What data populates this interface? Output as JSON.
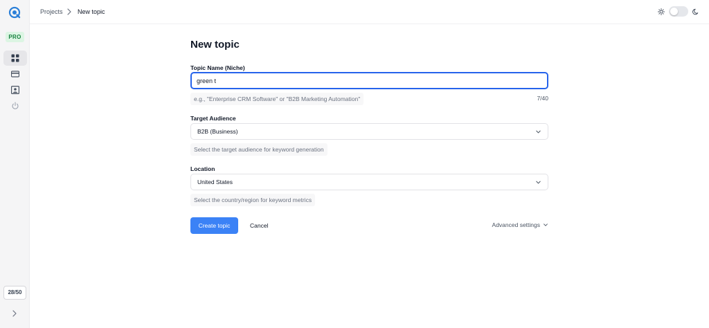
{
  "sidebar": {
    "badge": "PRO",
    "credits": "28/50",
    "items": [
      {
        "icon": "grid-icon",
        "active": true
      },
      {
        "icon": "card-icon",
        "active": false
      },
      {
        "icon": "user-card-icon",
        "active": false
      },
      {
        "icon": "power-icon",
        "active": false
      }
    ]
  },
  "header": {
    "breadcrumb": [
      "Projects",
      "New topic"
    ],
    "theme_toggle": {
      "icons": [
        "sun-icon",
        "moon-icon"
      ],
      "dark_mode": false
    }
  },
  "form": {
    "title": "New topic",
    "topic_name": {
      "label": "Topic Name (Niche)",
      "value": "green t",
      "hint": "e.g., \"Enterprise CRM Software\" or \"B2B Marketing Automation\"",
      "counter": "7/40"
    },
    "target_audience": {
      "label": "Target Audience",
      "value": "B2B (Business)",
      "hint": "Select the target audience for keyword generation"
    },
    "location": {
      "label": "Location",
      "value": "United States",
      "hint": "Select the country/region for keyword metrics"
    },
    "create_label": "Create topic",
    "cancel_label": "Cancel",
    "advanced_label": "Advanced settings"
  },
  "colors": {
    "accent": "#3b82f6",
    "focus_border": "#2563eb",
    "pro_badge_bg": "#dcf5e3",
    "pro_badge_text": "#15803d"
  }
}
